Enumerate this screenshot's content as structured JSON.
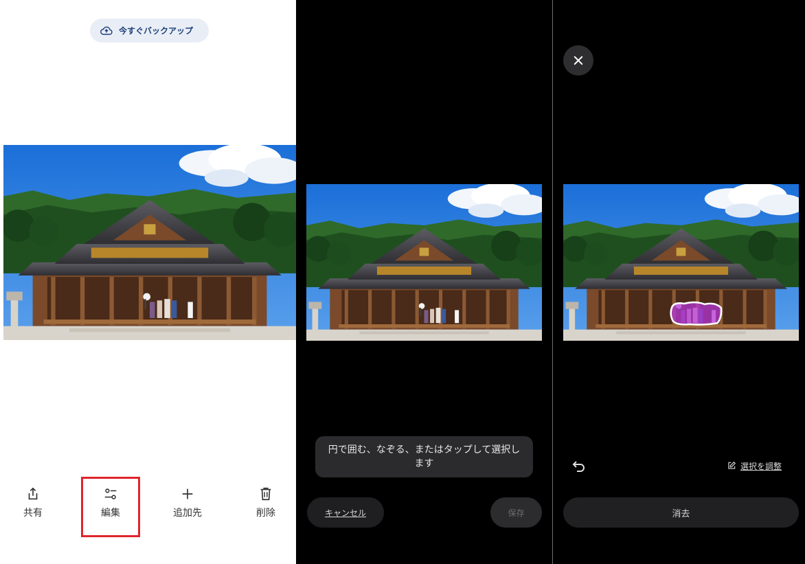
{
  "panel1": {
    "backup_label": "今すぐバックアップ",
    "actions": [
      {
        "label": "共有",
        "icon": "share-icon"
      },
      {
        "label": "編集",
        "icon": "edit-tune-icon"
      },
      {
        "label": "追加先",
        "icon": "plus-icon"
      },
      {
        "label": "削除",
        "icon": "trash-icon"
      }
    ],
    "highlight_color": "#e0242c"
  },
  "panel2": {
    "hint": "円で囲む、なぞる、またはタップして選択します",
    "cancel_label": "キャンセル",
    "save_label": "保存"
  },
  "panel3": {
    "adjust_label": "選択を調整",
    "erase_label": "消去",
    "selection_color": "#b536d6"
  }
}
